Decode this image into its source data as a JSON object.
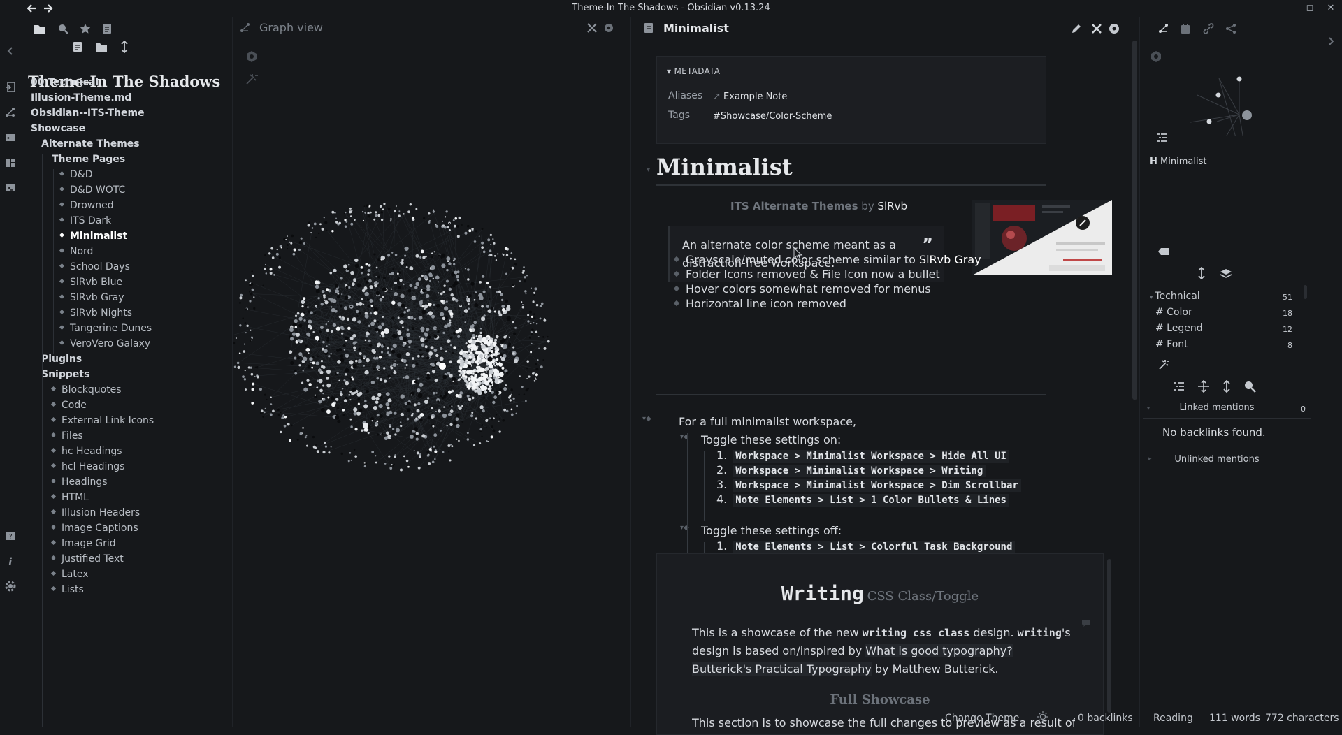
{
  "window": {
    "title": "Theme-In The Shadows - Obsidian v0.13.24"
  },
  "left_sidebar": {
    "vault_title": "Theme-In The Shadows",
    "tree": [
      {
        "label": "00 Technical",
        "kind": "folder",
        "depth": 0
      },
      {
        "label": "Illusion-Theme.md",
        "kind": "folder",
        "depth": 0
      },
      {
        "label": "Obsidian--ITS-Theme",
        "kind": "folder",
        "depth": 0
      },
      {
        "label": "Showcase",
        "kind": "folder",
        "depth": 0
      },
      {
        "label": "Alternate Themes",
        "kind": "folder",
        "depth": 1
      },
      {
        "label": "Theme Pages",
        "kind": "folder",
        "depth": 2
      },
      {
        "label": "D&D",
        "kind": "file",
        "depth": 3
      },
      {
        "label": "D&D WOTC",
        "kind": "file",
        "depth": 3
      },
      {
        "label": "Drowned",
        "kind": "file",
        "depth": 3
      },
      {
        "label": "ITS Dark",
        "kind": "file",
        "depth": 3
      },
      {
        "label": "Minimalist",
        "kind": "file",
        "depth": 3,
        "active": true
      },
      {
        "label": "Nord",
        "kind": "file",
        "depth": 3
      },
      {
        "label": "School Days",
        "kind": "file",
        "depth": 3
      },
      {
        "label": "SlRvb Blue",
        "kind": "file",
        "depth": 3
      },
      {
        "label": "SlRvb Gray",
        "kind": "file",
        "depth": 3
      },
      {
        "label": "SlRvb Nights",
        "kind": "file",
        "depth": 3
      },
      {
        "label": "Tangerine Dunes",
        "kind": "file",
        "depth": 3
      },
      {
        "label": "VeroVero Galaxy",
        "kind": "file",
        "depth": 3
      },
      {
        "label": "Plugins",
        "kind": "folder",
        "depth": 1
      },
      {
        "label": "Snippets",
        "kind": "folder",
        "depth": 1
      },
      {
        "label": "Blockquotes",
        "kind": "file",
        "depth": 2
      },
      {
        "label": "Code",
        "kind": "file",
        "depth": 2
      },
      {
        "label": "External Link Icons",
        "kind": "file",
        "depth": 2
      },
      {
        "label": "Files",
        "kind": "file",
        "depth": 2
      },
      {
        "label": "hc Headings",
        "kind": "file",
        "depth": 2
      },
      {
        "label": "hcl Headings",
        "kind": "file",
        "depth": 2
      },
      {
        "label": "Headings",
        "kind": "file",
        "depth": 2
      },
      {
        "label": "HTML",
        "kind": "file",
        "depth": 2
      },
      {
        "label": "Illusion Headers",
        "kind": "file",
        "depth": 2
      },
      {
        "label": "Image Captions",
        "kind": "file",
        "depth": 2
      },
      {
        "label": "Image Grid",
        "kind": "file",
        "depth": 2
      },
      {
        "label": "Justified Text",
        "kind": "file",
        "depth": 2
      },
      {
        "label": "Latex",
        "kind": "file",
        "depth": 2
      },
      {
        "label": "Lists",
        "kind": "file",
        "depth": 2
      }
    ]
  },
  "graph_pane": {
    "title": "Graph view"
  },
  "editor": {
    "tab_title": "Minimalist",
    "metadata": {
      "header": "METADATA",
      "aliases_key": "Aliases",
      "aliases_value": "Example Note",
      "tags_key": "Tags",
      "tags_value": "#Showcase/Color-Scheme"
    },
    "heading": "Minimalist",
    "its_line": {
      "name": "ITS Alternate Themes",
      "by": "by",
      "author": "SlRvb"
    },
    "callout_text": "An alternate color scheme meant as a distraction-free workspace.",
    "quote_mark": "”",
    "bullets": [
      {
        "text": "Grayscale/muted color scheme similar to ",
        "link": "SlRvb Gray"
      },
      {
        "text": "Folder Icons removed & File Icon now a bullet",
        "link": ""
      },
      {
        "text": "Hover colors somewhat removed for menus",
        "link": ""
      },
      {
        "text": "Horizontal line icon removed",
        "link": ""
      }
    ],
    "full_workspace": "For a full minimalist workspace,",
    "toggle_on": "Toggle these settings on:",
    "on_items": [
      {
        "num": "1.",
        "code": "Workspace > Minimalist Workspace > Hide All UI"
      },
      {
        "num": "2.",
        "code": "Workspace > Minimalist Workspace > Writing"
      },
      {
        "num": "3.",
        "code": "Workspace > Minimalist Workspace > Dim Scrollbar"
      },
      {
        "num": "4.",
        "code": "Note Elements > List > 1 Color Bullets & Lines"
      }
    ],
    "toggle_off": "Toggle these settings off:",
    "off_items": [
      {
        "num": "1.",
        "code": "Note Elements > List > Colorful Task Background"
      }
    ],
    "writing": {
      "title_big": "Writing",
      "title_small": "CSS Class/Toggle",
      "para_1a": "This is a showcase of the new ",
      "para_1b": "writing css class",
      "para_1c": " design. ",
      "para_1d": "writing",
      "para_1e": "'s design is based on/inspired by ",
      "para_1f": "What is good typography? Butterick's Practical Typography",
      "para_1g": " by Matthew Butterick.",
      "subheading": "Full Showcase",
      "para_2": "This section is to showcase the full changes to preview as a result of"
    }
  },
  "right_sidebar": {
    "outline_item": "Minimalist",
    "outline_prefix": "H",
    "tags": [
      {
        "label": "Technical",
        "count": "51",
        "collapsible": true
      },
      {
        "label": "# Color",
        "count": "18"
      },
      {
        "label": "# Legend",
        "count": "12"
      },
      {
        "label": "# Font",
        "count": "8"
      }
    ],
    "linked_mentions": "Linked mentions",
    "linked_count": "0",
    "no_backlinks": "No backlinks found.",
    "unlinked_mentions": "Unlinked mentions"
  },
  "status_bar": {
    "change_theme": "Change Theme",
    "backlinks": "0 backlinks",
    "mode": "Reading",
    "words": "111 words",
    "characters": "772 characters"
  },
  "colors": {
    "background": "#16181b",
    "panel": "#1c1e22",
    "text": "#d8dbe0",
    "muted": "#7c828a"
  }
}
